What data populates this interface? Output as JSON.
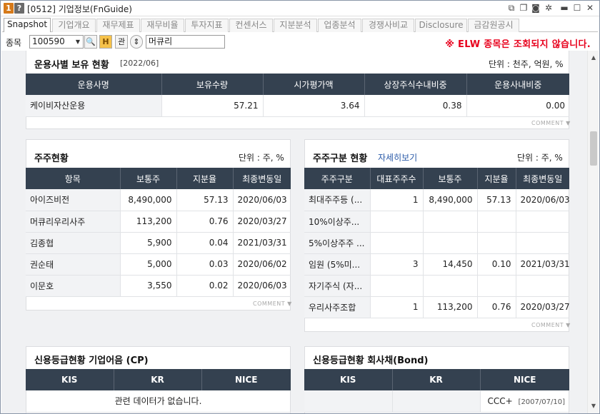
{
  "titlebar": {
    "badge1": "1",
    "badge2": "?",
    "title": "[0512] 기업정보(FnGuide)",
    "badge1_color": "#d67a1a",
    "badge2_color": "#6b6b6b"
  },
  "tabs": [
    {
      "label": "Snapshot"
    },
    {
      "label": "기업개요"
    },
    {
      "label": "재무제표"
    },
    {
      "label": "재무비율"
    },
    {
      "label": "투자지표"
    },
    {
      "label": "컨센서스"
    },
    {
      "label": "지분분석"
    },
    {
      "label": "업종분석"
    },
    {
      "label": "경쟁사비교"
    },
    {
      "label": "Disclosure"
    },
    {
      "label": "금감원공시"
    }
  ],
  "toolbar": {
    "label": "종목",
    "code": "100590",
    "search_btn": "🔍",
    "btn2": "H",
    "btn3": "관",
    "btn4": "⇕",
    "name": "머큐리",
    "notice": "※ ELW 종목은 조회되지 않습니다."
  },
  "fund": {
    "title": "운용사별 보유 현황",
    "date": "[2022/06]",
    "unit": "단위 : 천주, 억원, %",
    "headers": [
      "운용사명",
      "보유수량",
      "시가평가액",
      "상장주식수내비중",
      "운용사내비중"
    ],
    "rows": [
      [
        "케이비자산운용",
        "57.21",
        "3.64",
        "0.38",
        "0.00"
      ]
    ],
    "comment": "COMMENT ▼"
  },
  "holders": {
    "title": "주주현황",
    "unit": "단위 : 주, %",
    "headers": [
      "항목",
      "보통주",
      "지분율",
      "최종변동일"
    ],
    "rows": [
      [
        "아이즈비전",
        "8,490,000",
        "57.13",
        "2020/06/03"
      ],
      [
        "머큐리우리사주",
        "113,200",
        "0.76",
        "2020/03/27"
      ],
      [
        "김종협",
        "5,900",
        "0.04",
        "2021/03/31"
      ],
      [
        "권순태",
        "5,000",
        "0.03",
        "2020/06/02"
      ],
      [
        "이문호",
        "3,550",
        "0.02",
        "2020/06/03"
      ]
    ],
    "comment": "COMMENT ▼"
  },
  "holder_types": {
    "title": "주주구분 현황",
    "link": "자세히보기",
    "unit": "단위 : 주, %",
    "headers": [
      "주주구분",
      "대표주주수",
      "보통주",
      "지분율",
      "최종변동일"
    ],
    "rows": [
      [
        "최대주주등 (...",
        "1",
        "8,490,000",
        "57.13",
        "2020/06/03"
      ],
      [
        "10%이상주...",
        "",
        "",
        "",
        ""
      ],
      [
        "5%이상주주 ...",
        "",
        "",
        "",
        ""
      ],
      [
        "임원 (5%미...",
        "3",
        "14,450",
        "0.10",
        "2021/03/31"
      ],
      [
        "자기주식 (자...",
        "",
        "",
        "",
        ""
      ],
      [
        "우리사주조합",
        "1",
        "113,200",
        "0.76",
        "2020/03/27"
      ]
    ],
    "comment": "COMMENT ▼"
  },
  "credit_cp": {
    "title": "신용등급현황 기업어음 (CP)",
    "headers": [
      "KIS",
      "KR",
      "NICE"
    ],
    "empty": "관련 데이터가 없습니다."
  },
  "credit_bond": {
    "title": "신용등급현황 회사채(Bond)",
    "headers": [
      "KIS",
      "KR",
      "NICE"
    ],
    "nice_value": "CCC+",
    "nice_date": "[2007/07/10]"
  }
}
